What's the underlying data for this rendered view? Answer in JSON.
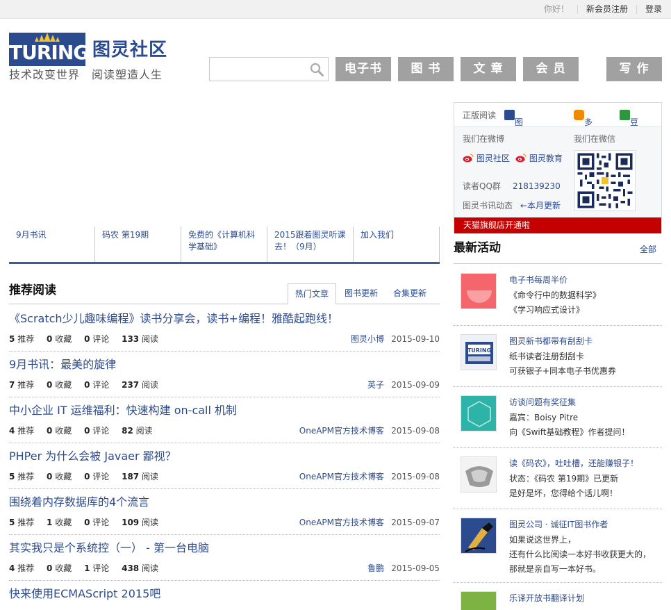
{
  "topbar": {
    "greeting": "你好！",
    "register": "新会员注册",
    "login": "登录"
  },
  "logo": {
    "wordmark": "TURING",
    "title": "图灵社区",
    "slogan": "技术改变世界　阅读塑造人生"
  },
  "search": {
    "value": "",
    "placeholder": ""
  },
  "nav": {
    "ebook": "电子书",
    "book": "图 书",
    "article": "文 章",
    "member": "会 员",
    "write": "写 作"
  },
  "news_tabs": [
    {
      "label": "9月书讯"
    },
    {
      "label": "码农 第19期"
    },
    {
      "label": "免费的《计算机科学基础》"
    },
    {
      "label": "2015跟着图灵听课去！（9月）"
    },
    {
      "label": "加入我们"
    }
  ],
  "recommended": {
    "title": "推荐阅读",
    "tabs": [
      "热门文章",
      "图书更新",
      "合集更新"
    ],
    "active_tab": "热门文章",
    "labels": {
      "recommend": "推荐",
      "favorite": "收藏",
      "comment": "评论",
      "read": "阅读"
    },
    "articles": [
      {
        "title": "《Scratch少儿趣味编程》读书分享会，读书+编程！雅酷起跑线！",
        "recommend": "5",
        "favorite": "0",
        "comment": "0",
        "read": "133",
        "author": "图灵小博",
        "date": "2015-09-10"
      },
      {
        "title": "9月书讯：最美的旋律",
        "recommend": "7",
        "favorite": "0",
        "comment": "0",
        "read": "237",
        "author": "英子",
        "date": "2015-09-09"
      },
      {
        "title": "中小企业 IT 运维福利：快速构建 on-call 机制",
        "recommend": "4",
        "favorite": "0",
        "comment": "0",
        "read": "82",
        "author": "OneAPM官方技术博客",
        "date": "2015-09-08"
      },
      {
        "title": "PHPer 为什么会被 Javaer 鄙视？",
        "recommend": "5",
        "favorite": "0",
        "comment": "0",
        "read": "187",
        "author": "OneAPM官方技术博客",
        "date": "2015-09-08"
      },
      {
        "title": "围绕着内存数据库的4个流言",
        "recommend": "5",
        "favorite": "1",
        "comment": "0",
        "read": "109",
        "author": "OneAPM官方技术博客",
        "date": "2015-09-07"
      },
      {
        "title": "其实我只是个系统控（一） - 第一台电脑",
        "recommend": "4",
        "favorite": "0",
        "comment": "1",
        "read": "438",
        "author": "鲁鹏",
        "date": "2015-09-05"
      },
      {
        "title": "快来使用ECMAScript 2015吧",
        "recommend": "",
        "favorite": "",
        "comment": "",
        "read": "",
        "author": "",
        "date": ""
      }
    ]
  },
  "sidebar": {
    "legal_reading": "正版阅读",
    "turing_ebook": "图灵电子书",
    "duokan": "多看",
    "douban": "豆瓣",
    "weibo_label": "我们在微博",
    "wechat_label": "我们在微信",
    "weibo_community": "图灵社区",
    "weibo_education": "图灵教育",
    "qq_label": "读者QQ群",
    "qq_number": "218139230",
    "news_label": "图灵书讯动态",
    "monthly_update": "←本月更新",
    "tmall": "天猫旗舰店开通啦"
  },
  "activities": {
    "title": "最新活动",
    "all": "全部",
    "items": [
      {
        "title": "电子书每周半价",
        "lines": [
          "《命令行中的数据科学》",
          "《学习响应式设计》"
        ]
      },
      {
        "title": "图灵新书都带有刮刮卡",
        "lines": [
          "纸书读者注册刮刮卡",
          "可获银子+同本电子书优惠券"
        ]
      },
      {
        "title": "访谈问题有奖征集",
        "lines": [
          "嘉宾：Boisy Pitre",
          "向《Swift基础教程》作者提问！"
        ]
      },
      {
        "title": "读《码农》，吐吐槽，还能赚银子！",
        "lines": [
          "状态：《码农 第19期》已更新",
          "是好是坏，您得给个话儿啊！"
        ]
      },
      {
        "title": "图灵公司 · 诚征IT图书作者",
        "lines": [
          "如果说这世界上，",
          "还有什么比阅读一本好书收获更大的，",
          "那就是亲自写一本好书。"
        ]
      },
      {
        "title": "乐译开放书翻译计划",
        "lines": []
      }
    ]
  },
  "colors": {
    "brand_blue": "#2c4b8e",
    "nav_gray": "#a1a1a1",
    "tmall_red": "#c40000"
  }
}
